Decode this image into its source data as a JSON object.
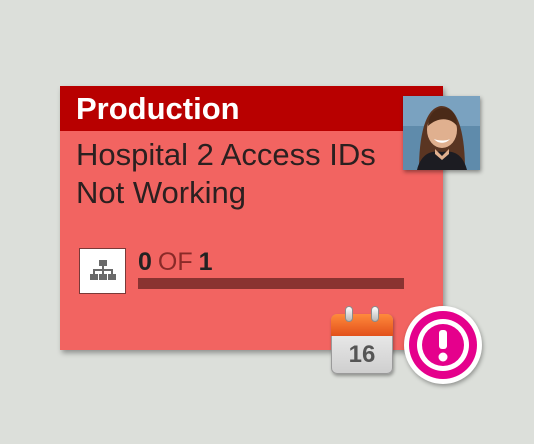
{
  "card": {
    "header_title": "Production",
    "title": "Hospital 2 Access IDs Not Working",
    "header_color": "#b80000",
    "background_color": "#f26461"
  },
  "avatar": {
    "icon": "user-avatar-photo"
  },
  "progress": {
    "completed": "0",
    "of_label": "OF",
    "total": "1",
    "fraction": 0.0,
    "track_color": "#8a3331"
  },
  "hierarchy_button": {
    "icon": "hierarchy-icon"
  },
  "calendar": {
    "icon": "calendar-icon",
    "day": "16"
  },
  "alert": {
    "icon": "exclamation-alert-icon",
    "color": "#e5008c"
  }
}
